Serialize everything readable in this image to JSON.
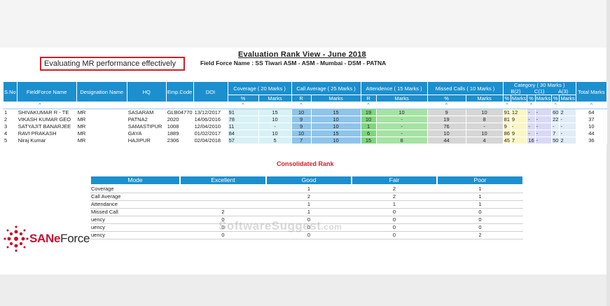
{
  "callout": "Evaluating MR performance effectively",
  "title": "Evaluation Rank View - June 2018",
  "subtitle": "Field Force Name : SS Tiwari ASM - ASM - Mumbai - DSM - PATNA",
  "rank_table": {
    "headers": {
      "sno": "S.No",
      "name": "FieldForce Name",
      "designation": "Designation Name",
      "hq": "HQ",
      "emp_code": "Emp.Code",
      "doi": "DOI",
      "coverage": "Coverage ( 20 Marks )",
      "call_average": "Call Average ( 25 Marks )",
      "attendance": "Attendence ( 15 Marks )",
      "missed_calls": "Missed Calls ( 10 Marks )",
      "category": "Category ( 30 Marks )",
      "total": "Total Marks",
      "b": "B(2)",
      "c": "C(1)",
      "a": "A(3)"
    },
    "subheaders": {
      "pct": "%",
      "marks": "Marks",
      "r": "R"
    },
    "sort_arrow": "^",
    "rows": [
      {
        "sno": "1",
        "name": "SHIVAKUMAR R - TE",
        "designation": "MR",
        "hq": "SASARAM",
        "emp_code": "GLB04770",
        "doi": "13/12/2017",
        "cov_pct": "91",
        "cov_marks": "15",
        "call_r": "10",
        "call_marks": "15",
        "att_r": "19",
        "att_marks": "10",
        "mis_pct": "9",
        "mis_marks": "10",
        "b_pct": "91",
        "b_marks": "12",
        "c_pct": "-",
        "c_marks": "-",
        "a_pct": "60",
        "a_marks": "2",
        "total": "64"
      },
      {
        "sno": "2",
        "name": "VIKASH KUMAR GEO",
        "designation": "MR",
        "hq": "PATNA2",
        "emp_code": "2020",
        "doi": "14/06/2016",
        "cov_pct": "78",
        "cov_marks": "10",
        "call_r": "9",
        "call_marks": "10",
        "att_r": "10",
        "att_marks": "-",
        "mis_pct": "19",
        "mis_marks": "8",
        "b_pct": "81",
        "b_marks": "9",
        "c_pct": "-",
        "c_marks": "-",
        "a_pct": "22",
        "a_marks": "-",
        "total": "37"
      },
      {
        "sno": "3",
        "name": "SATYAJIT BANARJEE",
        "designation": "MR",
        "hq": "SAMASTIPUR",
        "emp_code": "1008",
        "doi": "12/04/2010",
        "cov_pct": "11",
        "cov_marks": "-",
        "call_r": "9",
        "call_marks": "10",
        "att_r": "1",
        "att_marks": "-",
        "mis_pct": "76",
        "mis_marks": "-",
        "b_pct": "9",
        "b_marks": "-",
        "c_pct": "-",
        "c_marks": "-",
        "a_pct": "-",
        "a_marks": "-",
        "total": "10"
      },
      {
        "sno": "4",
        "name": "RAVI PRAKASH",
        "designation": "MR",
        "hq": "GAYA",
        "emp_code": "1889",
        "doi": "01/02/2017",
        "cov_pct": "84",
        "cov_marks": "10",
        "call_r": "10",
        "call_marks": "15",
        "att_r": "6",
        "att_marks": "-",
        "mis_pct": "10",
        "mis_marks": "10",
        "b_pct": "86",
        "b_marks": "9",
        "c_pct": "-",
        "c_marks": "-",
        "a_pct": "7",
        "a_marks": "-",
        "total": "44"
      },
      {
        "sno": "5",
        "name": "Niraj Kumar",
        "designation": "MR",
        "hq": "HAJIPUR",
        "emp_code": "2306",
        "doi": "02/04/2018",
        "cov_pct": "57",
        "cov_marks": "5",
        "call_r": "7",
        "call_marks": "10",
        "att_r": "15",
        "att_marks": "8",
        "mis_pct": "44",
        "mis_marks": "4",
        "b_pct": "45",
        "b_marks": "7",
        "c_pct": "16",
        "c_marks": "-",
        "a_pct": "50",
        "a_marks": "2",
        "total": "36"
      }
    ]
  },
  "consolidated": {
    "title": "Consolidated Rank",
    "headers": [
      "Mode",
      "Excellent",
      "Good",
      "Fair",
      "Poor"
    ],
    "rows": [
      {
        "mode": "Coverage",
        "excellent": "",
        "good": "1",
        "fair": "2",
        "poor": "1"
      },
      {
        "mode": "Call Average",
        "excellent": "",
        "good": "2",
        "fair": "2",
        "poor": "1"
      },
      {
        "mode": "Attendance",
        "excellent": "",
        "good": "1",
        "fair": "1",
        "poor": "1"
      },
      {
        "mode": "Missed Call",
        "excellent": "2",
        "good": "1",
        "fair": "0",
        "poor": "0"
      },
      {
        "mode": "uency",
        "excellent": "0",
        "good": "0",
        "fair": "0",
        "poor": "0"
      },
      {
        "mode": "uency",
        "excellent": "0",
        "good": "0",
        "fair": "0",
        "poor": "0"
      },
      {
        "mode": "uency",
        "excellent": "0",
        "good": "0",
        "fair": "0",
        "poor": "2"
      }
    ]
  },
  "watermark": {
    "text": "SoftwareSuggest",
    "suffix": ".com"
  },
  "logo": {
    "name_main": "SANe",
    "name_light": "Force"
  },
  "colors": {
    "header_blue": "#1c8fcf",
    "coverage": "#d8f1f6",
    "call": "#8fc4ea",
    "attendance": "#7ed67c",
    "missed": "#d6d6d6",
    "brand_red": "#c8102e",
    "callout_border": "#d21f26"
  }
}
